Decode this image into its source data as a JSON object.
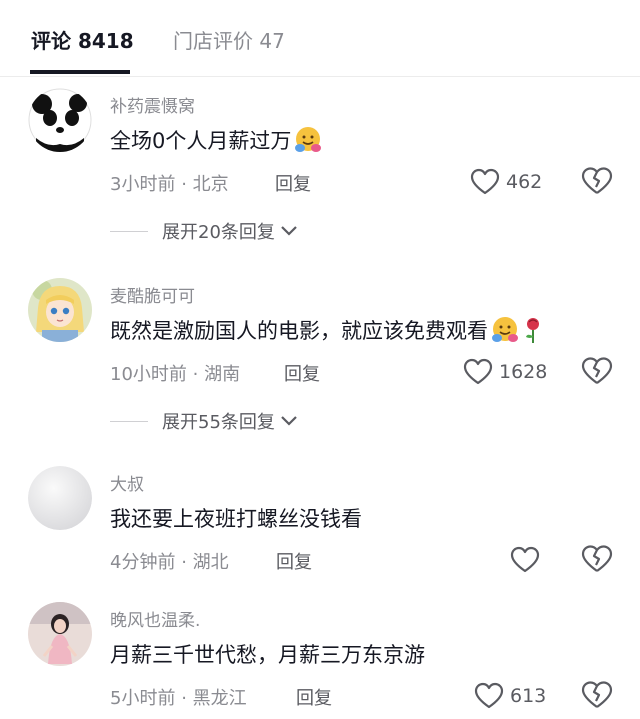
{
  "tabs": {
    "comments_label": "评论 8418",
    "store_reviews_label": "门店评价 47"
  },
  "comments": [
    {
      "username": "补药震慑窝",
      "text": "全场0个人月薪过万",
      "emojis": [
        "hug-emoji"
      ],
      "time": "3小时前",
      "location": "北京",
      "reply_label": "回复",
      "likes": "462",
      "expand_label": "展开20条回复"
    },
    {
      "username": "麦酷脆可可",
      "text": "既然是激励国人的电影，就应该免费观看",
      "emojis": [
        "hug-emoji",
        "rose-emoji"
      ],
      "time": "10小时前",
      "location": "湖南",
      "reply_label": "回复",
      "likes": "1628",
      "expand_label": "展开55条回复"
    },
    {
      "username": "大叔",
      "text": "我还要上夜班打螺丝没钱看",
      "time": "4分钟前",
      "location": "湖北",
      "reply_label": "回复",
      "likes": ""
    },
    {
      "username": "晚风也温柔.",
      "text": "月薪三千世代愁，月薪三万东京游",
      "time": "5小时前",
      "location": "黑龙江",
      "reply_label": "回复",
      "likes": "613"
    }
  ],
  "meta_separator": "·",
  "colors": {
    "text_primary": "#161823",
    "text_secondary": "#8a8b91",
    "divider": "#ececec"
  }
}
